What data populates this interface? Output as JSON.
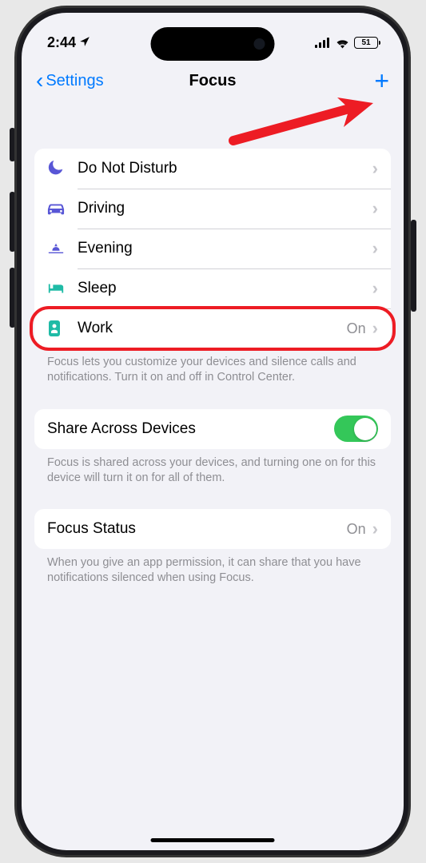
{
  "status": {
    "time": "2:44",
    "battery": "51"
  },
  "nav": {
    "back": "Settings",
    "title": "Focus"
  },
  "focusModes": [
    {
      "label": "Do Not Disturb",
      "iconColor": "#5856d6"
    },
    {
      "label": "Driving",
      "iconColor": "#5856d6"
    },
    {
      "label": "Evening",
      "iconColor": "#5856d6"
    },
    {
      "label": "Sleep",
      "iconColor": "#1fbba6"
    },
    {
      "label": "Work",
      "value": "On",
      "iconColor": "#1fbba6"
    }
  ],
  "focusFooter": "Focus lets you customize your devices and silence calls and notifications. Turn it on and off in Control Center.",
  "share": {
    "label": "Share Across Devices",
    "footer": "Focus is shared across your devices, and turning one on for this device will turn it on for all of them."
  },
  "focusStatus": {
    "label": "Focus Status",
    "value": "On",
    "footer": "When you give an app permission, it can share that you have notifications silenced when using Focus."
  }
}
